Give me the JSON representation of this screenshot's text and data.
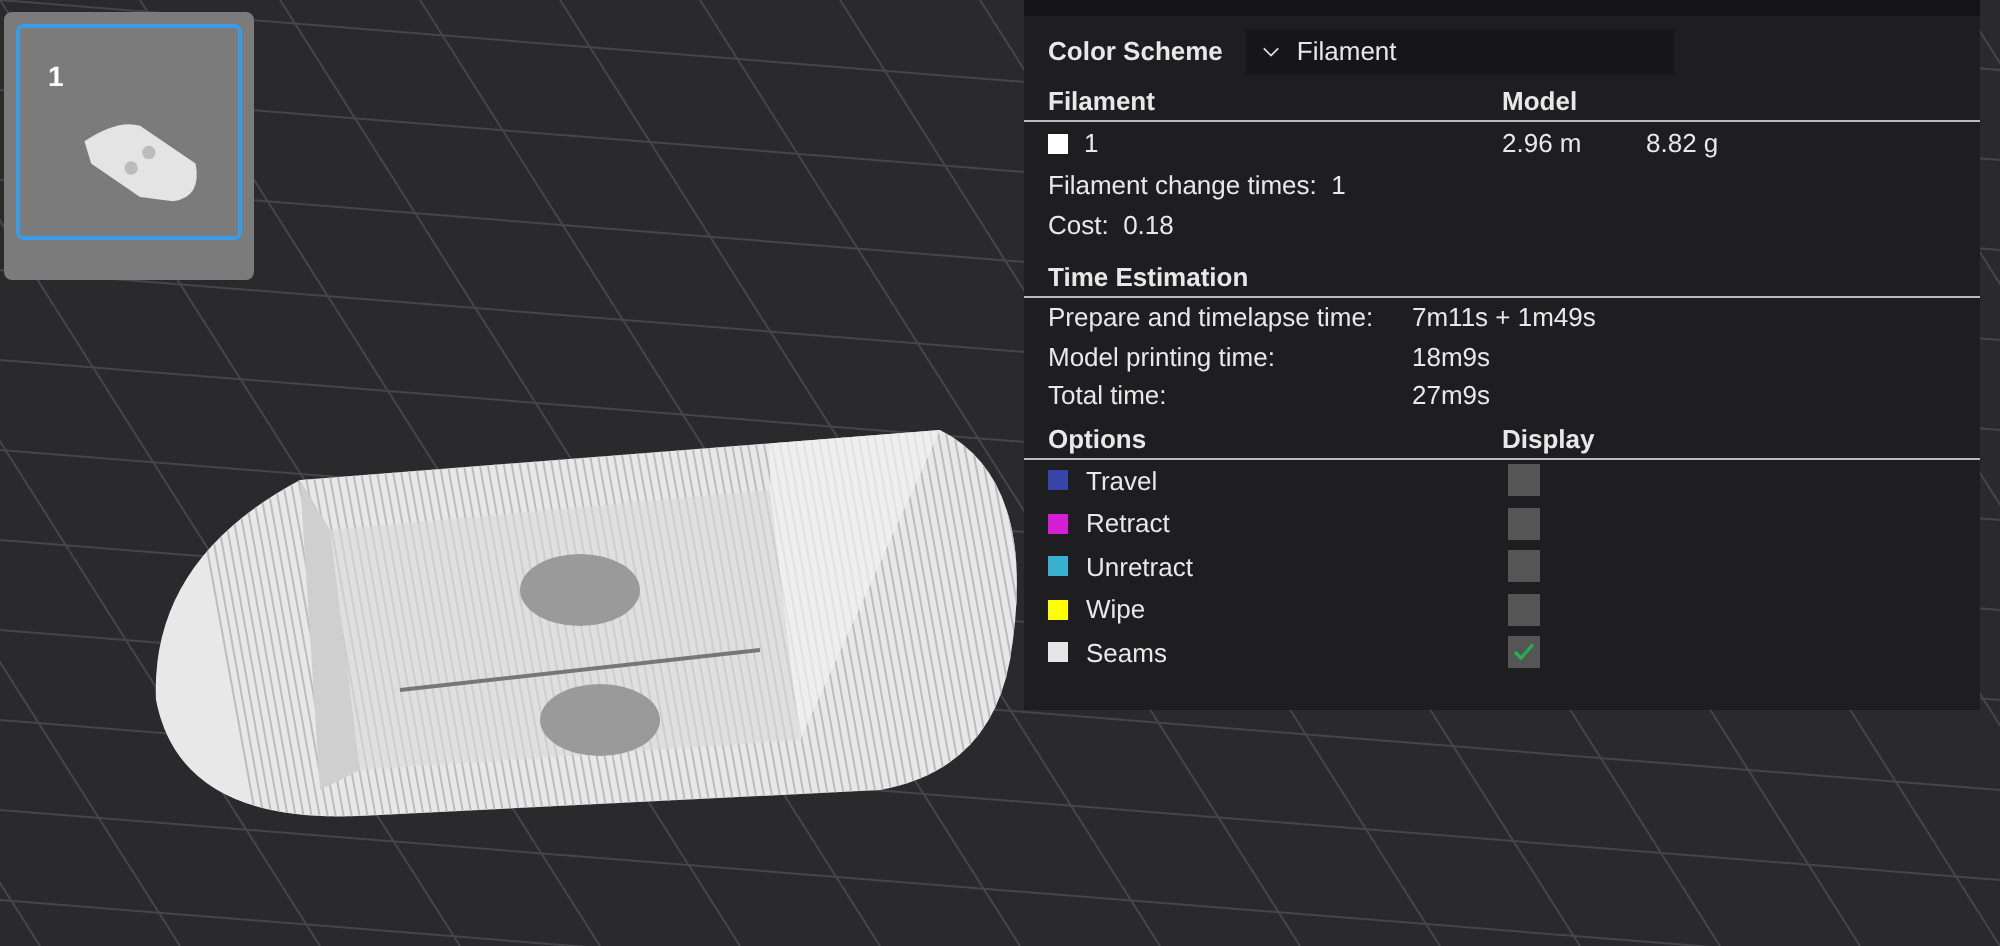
{
  "plate_thumbnail": {
    "label": "1",
    "selected": true
  },
  "panel": {
    "color_scheme": {
      "label": "Color Scheme",
      "value": "Filament"
    },
    "filament_table": {
      "columns": [
        "Filament",
        "Model"
      ],
      "rows": [
        {
          "color": "#ffffff",
          "name": "1",
          "length": "2.96 m",
          "weight": "8.82 g"
        }
      ]
    },
    "stats": [
      {
        "label": "Filament change times:",
        "value": "1"
      },
      {
        "label": "Cost:",
        "value": "0.18"
      }
    ],
    "time_estimation": {
      "title": "Time Estimation",
      "rows": [
        {
          "label": "Prepare and timelapse time:",
          "value": "7m11s + 1m49s"
        },
        {
          "label": "Model printing time:",
          "value": "18m9s"
        },
        {
          "label": "Total time:",
          "value": "27m9s"
        }
      ]
    },
    "options": {
      "columns": [
        "Options",
        "Display"
      ],
      "items": [
        {
          "color": "#3845a8",
          "label": "Travel",
          "checked": false
        },
        {
          "color": "#d41fd4",
          "label": "Retract",
          "checked": false
        },
        {
          "color": "#3ab0d0",
          "label": "Unretract",
          "checked": false
        },
        {
          "color": "#ffff00",
          "label": "Wipe",
          "checked": false
        },
        {
          "color": "#e6e6e6",
          "label": "Seams",
          "checked": true
        }
      ]
    }
  }
}
